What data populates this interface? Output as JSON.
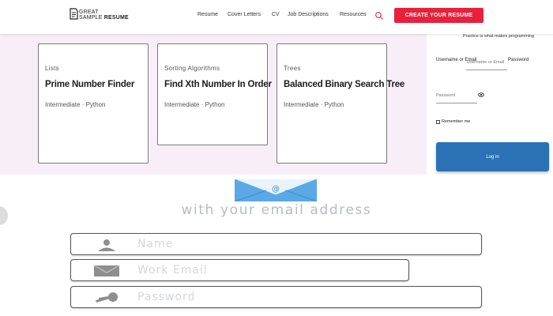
{
  "header": {
    "logo_line1": "GREAT",
    "logo_line2_a": "SAMPLE ",
    "logo_line2_b": "RESUME",
    "nav": [
      "Resume",
      "Cover Letters",
      "CV",
      "Job Descriptions",
      "Resources"
    ],
    "cta_label": "CREATE YOUR RESUME",
    "accent_color": "#e8203c"
  },
  "cards": [
    {
      "category": "Lists",
      "title": "Prime Number Finder",
      "meta": "Intermediate · Python"
    },
    {
      "category": "Sorting Algorithms",
      "title": "Find Xth Number In Order",
      "meta": "Intermediate · Python"
    },
    {
      "category": "Trees",
      "title": "Balanced Binary Search Tree",
      "meta": "Intermediate · Python"
    }
  ],
  "login": {
    "top_text": "Practice is what makes programming",
    "username_label": "Username or Email",
    "username_placeholder": "Username or Email",
    "password_label": "Password",
    "password_placeholder": "Password",
    "remember_label": "Remember me",
    "login_button": "Log in",
    "button_color": "#2a72b5"
  },
  "signup": {
    "headline": "with your email address",
    "name_placeholder": "Name",
    "email_placeholder": "Work Email",
    "password_placeholder": "Password"
  },
  "icons": [
    "logo-mark-icon",
    "search-icon",
    "eye-icon",
    "envelope-icon",
    "user-icon",
    "mail-icon",
    "key-icon"
  ]
}
